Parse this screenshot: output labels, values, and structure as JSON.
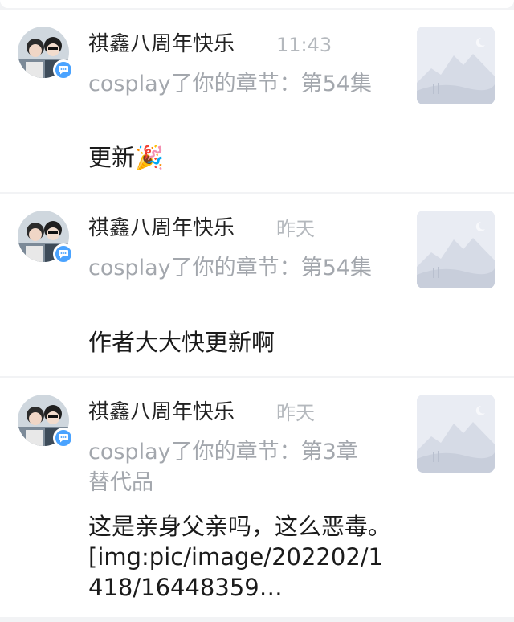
{
  "notifications": [
    {
      "user": "祺鑫八周年快乐",
      "time": "11:43",
      "reference": "cosplay了你的章节：第54集",
      "comment": "更新🎉"
    },
    {
      "user": "祺鑫八周年快乐",
      "time": "昨天",
      "reference": "cosplay了你的章节：第54集",
      "comment": "作者大大快更新啊"
    },
    {
      "user": "祺鑫八周年快乐",
      "time": "昨天",
      "reference": "cosplay了你的章节：第3章 替代品",
      "comment": "这是亲身父亲吗，这么恶毒。[img:pic/image/202202/1418/16448359…"
    }
  ],
  "colors": {
    "badge": "#4aa3ff",
    "name": "#222222",
    "secondary": "#a3a7ad"
  },
  "icons": {
    "badge": "comment-bubble-icon",
    "thumbnail": "placeholder-mountain-icon"
  }
}
